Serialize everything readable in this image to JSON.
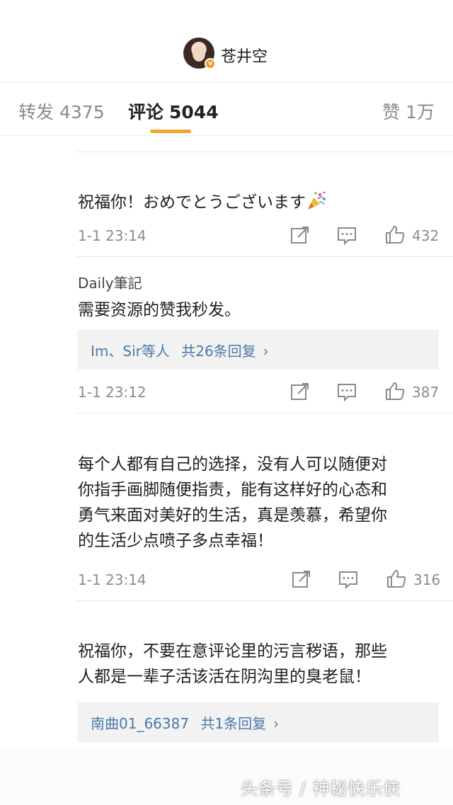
{
  "header": {
    "username": "苍井空",
    "verified_badge": "v"
  },
  "tabs": [
    {
      "label": "转发",
      "count": "4375"
    },
    {
      "label": "评论",
      "count": "5044"
    },
    {
      "label": "赞",
      "count": "1万"
    }
  ],
  "accent_color": "#f0a830",
  "link_color": "#4a78a8",
  "icons": [
    "repost-icon",
    "comment-icon",
    "like-icon",
    "party-popper-icon",
    "chevron-right-icon"
  ],
  "comments": [
    {
      "text": "祝福你！おめでとうございます",
      "time": "1-1 23:14",
      "likes": "432"
    },
    {
      "name": "Daily筆記",
      "text": "需要资源的赞我秒发。",
      "reply_users": "Im、Sir等人",
      "reply_count": "共26条回复",
      "time": "1-1 23:12",
      "likes": "387"
    },
    {
      "text_lines": [
        "每个人都有自己的选择，没有人可以随便对",
        "你指手画脚随便指责，能有这样好的心态和",
        "勇气来面对美好的生活，真是羡慕，希望你",
        "的生活少点喷子多点幸福！"
      ],
      "time": "1-1 23:14",
      "likes": "316"
    },
    {
      "text_lines": [
        "祝福你，不要在意评论里的污言秽语，那些",
        "人都是一辈子活该活在阴沟里的臭老鼠！"
      ],
      "reply_users": "南曲01_66387",
      "reply_count": "共1条回复"
    }
  ],
  "watermark": "头条号 / 神秘快乐侠"
}
